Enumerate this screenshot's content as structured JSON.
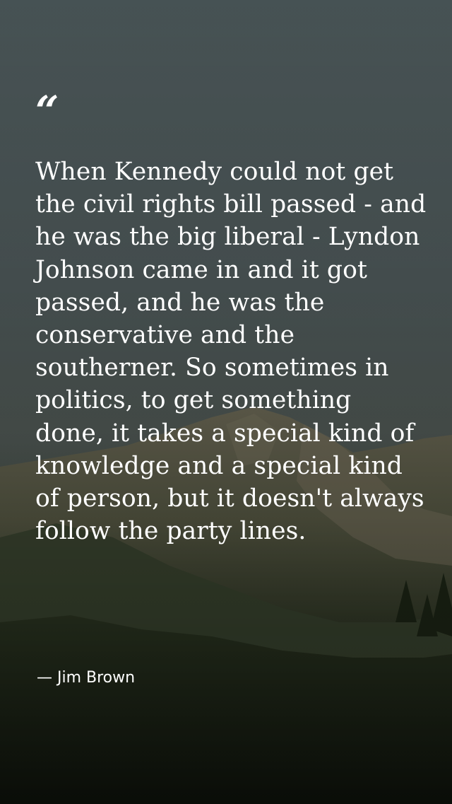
{
  "quote": {
    "mark": "“",
    "text": "When Kennedy could not get the civil rights bill passed - and he was the big liberal - Lyndon Johnson came in and it got passed, and he was the conservative and the southerner. So sometimes in politics, to get something done, it takes a special kind of knowledge and a special kind of person, but it doesn't always follow the party lines.",
    "author": "— Jim Brown"
  },
  "colors": {
    "text": "#ffffff",
    "sky": "#4f5a5b",
    "mountain": "#6b6a55",
    "foreground": "#1a2214"
  },
  "background": {
    "scene": "mountain-landscape"
  }
}
